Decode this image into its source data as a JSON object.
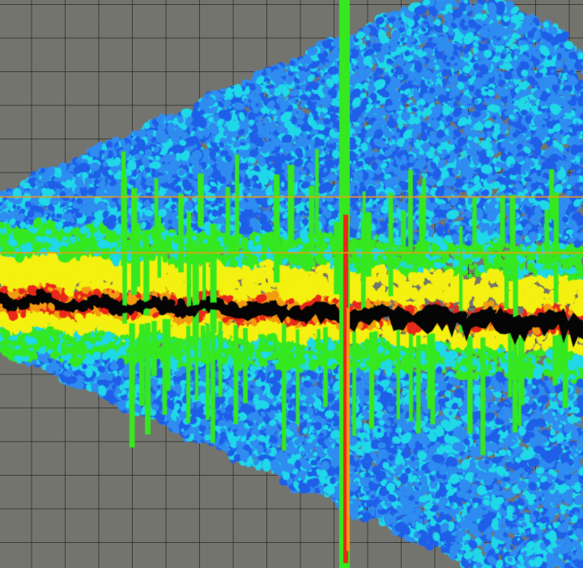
{
  "palette": {
    "background": "#74746f",
    "grid": "#2a2a28",
    "deep_blue": "#1f5fe8",
    "blue": "#2f8cf0",
    "cyan": "#1fd8e8",
    "green": "#35e820",
    "yellow": "#f4f010",
    "orange": "#f39a10",
    "red": "#e8281a",
    "black": "#050505"
  }
}
